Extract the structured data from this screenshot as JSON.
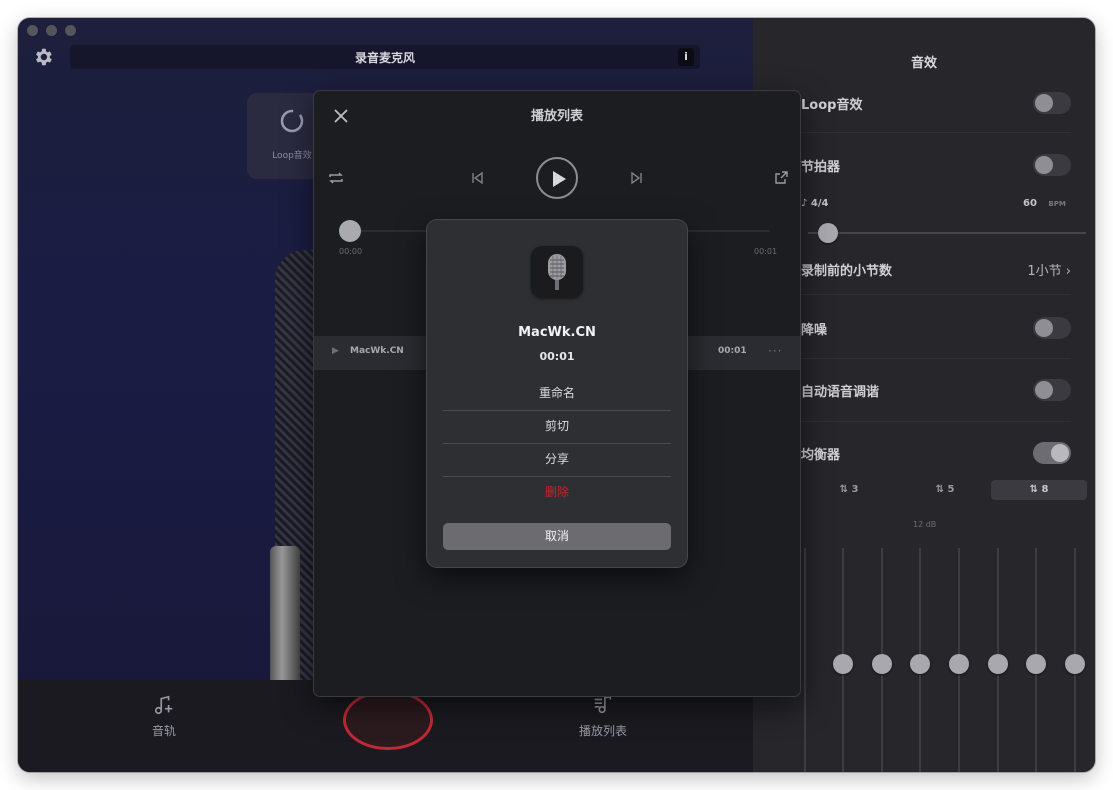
{
  "window": {
    "title": "录音麦克风",
    "info_label": "i"
  },
  "main": {
    "loop_tile_label": "Loop音效",
    "bottom": {
      "tracks_label": "音轨",
      "playlist_label": "播放列表"
    }
  },
  "effects_panel": {
    "title": "音效",
    "loop_label": "Loop音效",
    "loop_on": false,
    "metronome_label": "节拍器",
    "metronome_on": false,
    "time_signature": "4/4",
    "bpm_value": "60",
    "bpm_unit": "BPM",
    "precount_label": "录制前的小节数",
    "precount_value": "1小节",
    "noise_label": "降噪",
    "noise_on": false,
    "autotune_label": "自动语音调谐",
    "autotune_on": false,
    "eq_label": "均衡器",
    "eq_on": true,
    "eq_bands": [
      "3",
      "5",
      "8"
    ],
    "eq_selected_band": "8",
    "eq_db_label": "12 dB"
  },
  "playlist_dialog": {
    "title": "播放列表",
    "time_start": "00:00",
    "time_end": "00:01",
    "item": {
      "name": "MacWk.CN",
      "duration": "00:01",
      "more": "···"
    }
  },
  "action_sheet": {
    "name": "MacWk.CN",
    "duration": "00:01",
    "rename": "重命名",
    "cut": "剪切",
    "share": "分享",
    "delete": "删除",
    "cancel": "取消"
  },
  "colors": {
    "accent_red": "#c0262f",
    "panel_bg": "#26262b",
    "main_bg": "#1a1c44"
  }
}
